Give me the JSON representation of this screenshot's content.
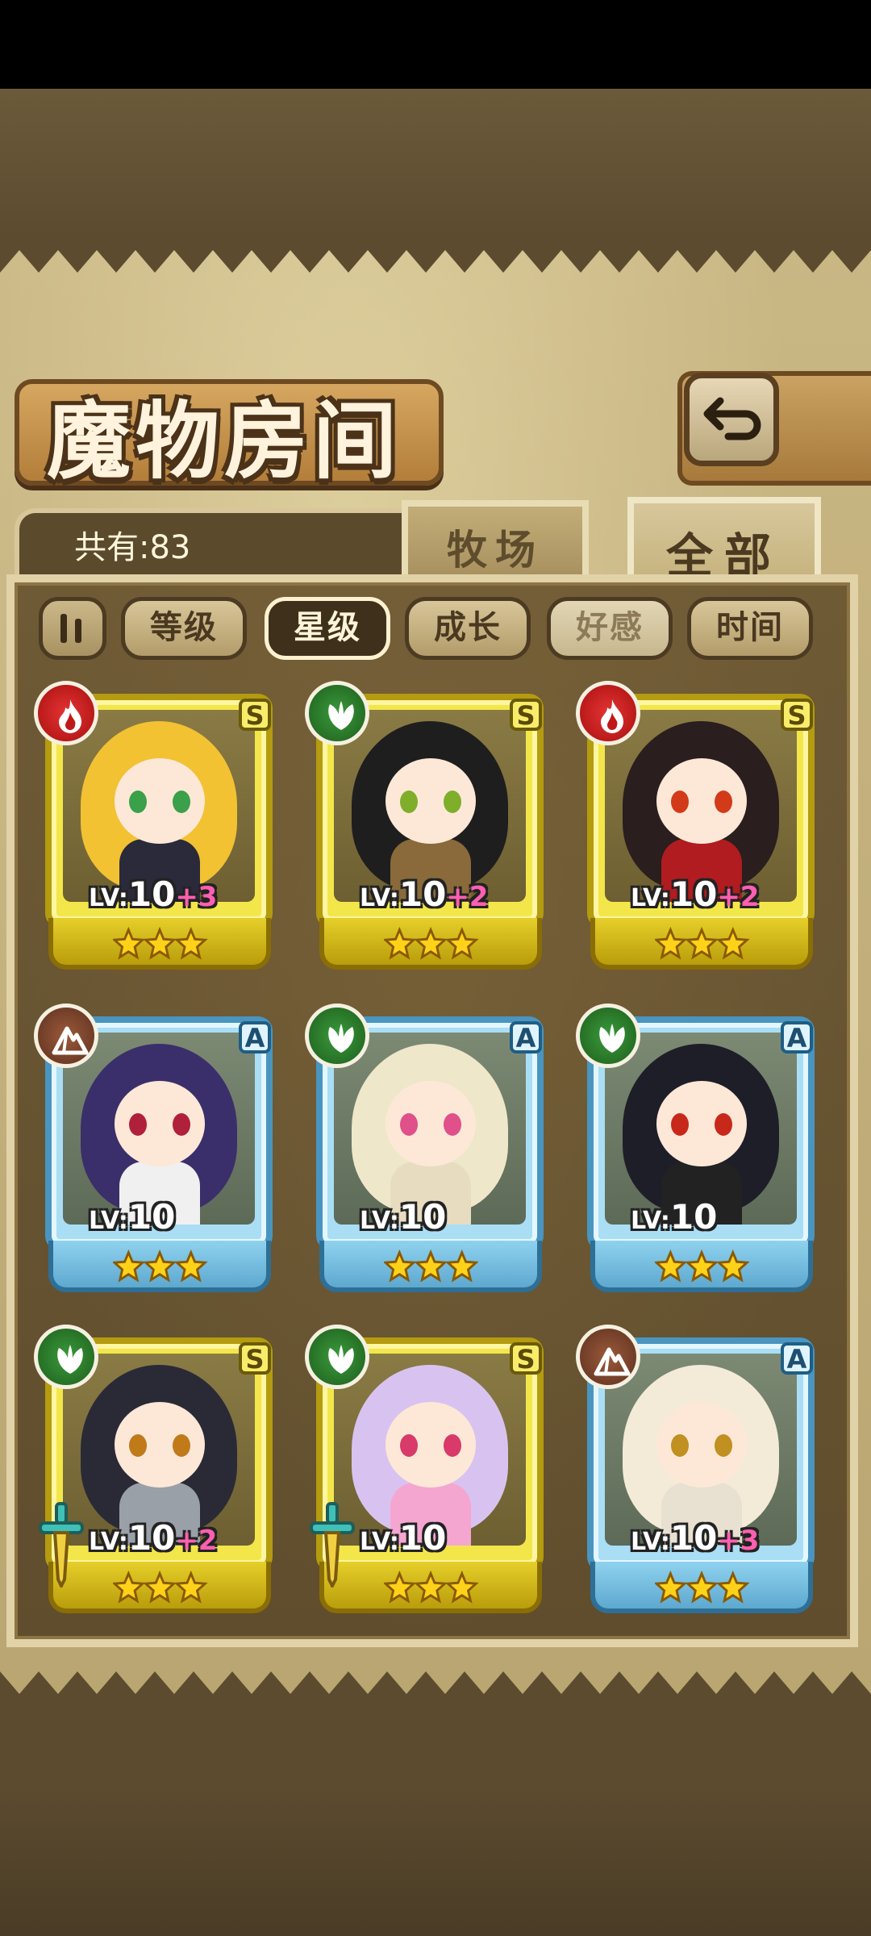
{
  "header": {
    "title": "魔物房间"
  },
  "count": {
    "text": "共有:83"
  },
  "tabs": {
    "pasture": "牧场",
    "all": "全部"
  },
  "filters": [
    {
      "label": "等级",
      "state": "normal"
    },
    {
      "label": "星级",
      "state": "active"
    },
    {
      "label": "成长",
      "state": "normal"
    },
    {
      "label": "好感",
      "state": "dim"
    },
    {
      "label": "时间",
      "state": "normal"
    }
  ],
  "colors": {
    "gold_frame": "#f3e64a",
    "blue_frame": "#a9def5",
    "fire": "#d42020",
    "nature": "#2e7d2e",
    "earth": "#7a4530",
    "bonus": "#ff5fb0"
  },
  "cards": [
    {
      "rank": "S",
      "element": "fire",
      "level_label": "LV:",
      "level": "10",
      "bonus": "+3",
      "stars": 3,
      "weapon": false
    },
    {
      "rank": "S",
      "element": "nature",
      "level_label": "LV:",
      "level": "10",
      "bonus": "+2",
      "stars": 3,
      "weapon": false
    },
    {
      "rank": "S",
      "element": "fire",
      "level_label": "LV:",
      "level": "10",
      "bonus": "+2",
      "stars": 3,
      "weapon": false
    },
    {
      "rank": "A",
      "element": "earth",
      "level_label": "LV:",
      "level": "10",
      "bonus": "",
      "stars": 3,
      "weapon": false
    },
    {
      "rank": "A",
      "element": "nature",
      "level_label": "LV:",
      "level": "10",
      "bonus": "",
      "stars": 3,
      "weapon": false
    },
    {
      "rank": "A",
      "element": "nature",
      "level_label": "LV:",
      "level": "10",
      "bonus": "",
      "stars": 3,
      "weapon": false
    },
    {
      "rank": "S",
      "element": "nature",
      "level_label": "LV:",
      "level": "10",
      "bonus": "+2",
      "stars": 3,
      "weapon": true
    },
    {
      "rank": "S",
      "element": "nature",
      "level_label": "LV:",
      "level": "10",
      "bonus": "",
      "stars": 3,
      "weapon": true
    },
    {
      "rank": "A",
      "element": "earth",
      "level_label": "LV:",
      "level": "10",
      "bonus": "+3",
      "stars": 3,
      "weapon": false
    }
  ]
}
